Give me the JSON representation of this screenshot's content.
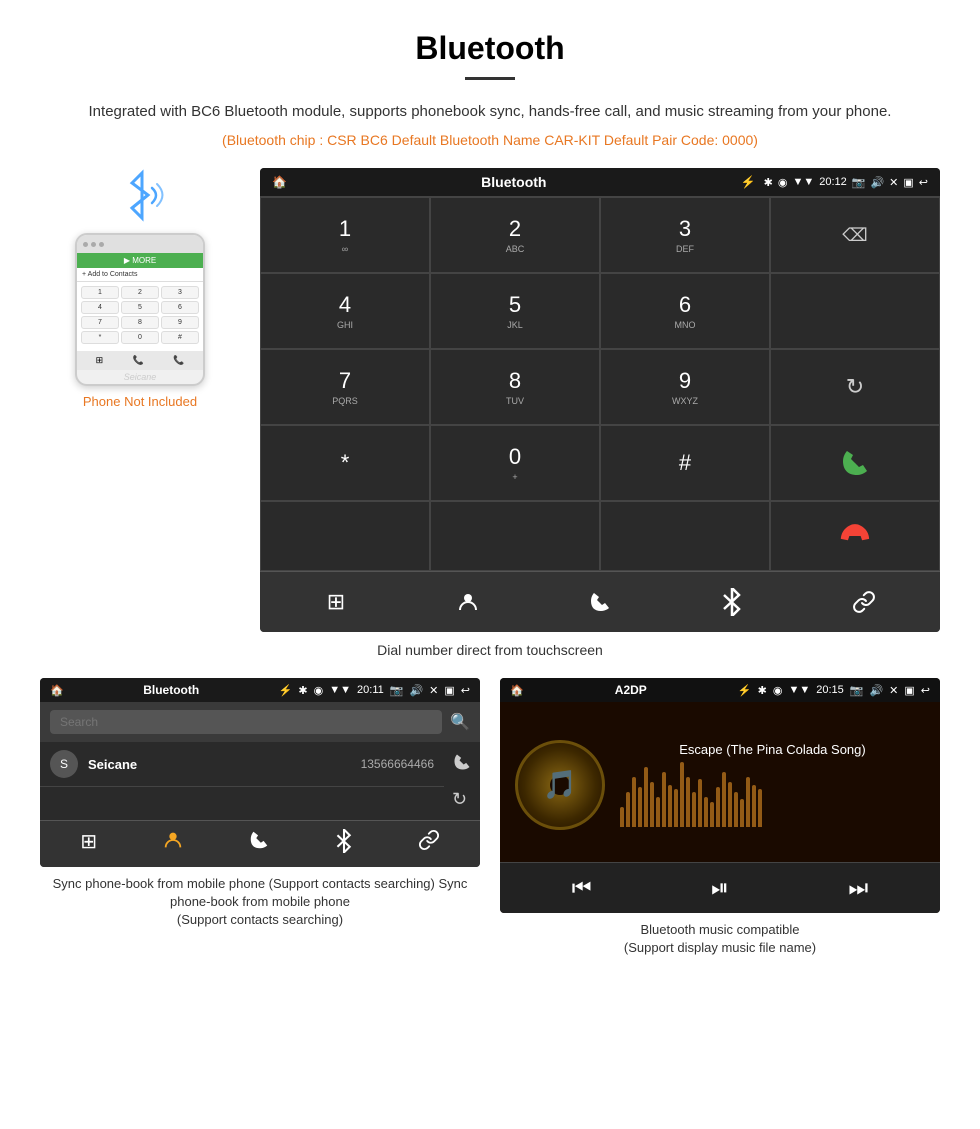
{
  "page": {
    "title": "Bluetooth",
    "divider": true,
    "description": "Integrated with BC6 Bluetooth module, supports phonebook sync, hands-free call, and music streaming from your phone.",
    "specs": "(Bluetooth chip : CSR BC6    Default Bluetooth Name CAR-KIT    Default Pair Code: 0000)",
    "main_caption": "Dial number direct from touchscreen",
    "phone_not_included": "Phone Not Included",
    "watermark": "Seicane"
  },
  "main_screen": {
    "status_bar": {
      "home_icon": "🏠",
      "title": "Bluetooth",
      "usb_icon": "⚡",
      "bluetooth_icon": "✱",
      "location_icon": "◉",
      "signal_icon": "▼",
      "time": "20:12",
      "camera_icon": "📷",
      "volume_icon": "🔊",
      "close_icon": "✕",
      "window_icon": "▣",
      "back_icon": "↩"
    },
    "dialpad": [
      {
        "label": "1",
        "sub": "∞",
        "col": 1
      },
      {
        "label": "2",
        "sub": "ABC",
        "col": 2
      },
      {
        "label": "3",
        "sub": "DEF",
        "col": 3
      },
      {
        "label": "",
        "sub": "",
        "col": 4,
        "type": "backspace",
        "icon": "⌫"
      },
      {
        "label": "4",
        "sub": "GHI",
        "col": 1
      },
      {
        "label": "5",
        "sub": "JKL",
        "col": 2
      },
      {
        "label": "6",
        "sub": "MNO",
        "col": 3
      },
      {
        "label": "",
        "sub": "",
        "col": 4,
        "type": "empty"
      },
      {
        "label": "7",
        "sub": "PQRS",
        "col": 1
      },
      {
        "label": "8",
        "sub": "TUV",
        "col": 2
      },
      {
        "label": "9",
        "sub": "WXYZ",
        "col": 3
      },
      {
        "label": "",
        "sub": "",
        "col": 4,
        "type": "refresh",
        "icon": "↻"
      },
      {
        "label": "*",
        "sub": "",
        "col": 1
      },
      {
        "label": "0",
        "sub": "+",
        "col": 2
      },
      {
        "label": "#",
        "sub": "",
        "col": 3
      },
      {
        "label": "📞",
        "sub": "",
        "col": 4,
        "type": "call-green"
      },
      {
        "label": "📞",
        "sub": "",
        "col": 4,
        "type": "call-red"
      }
    ],
    "bottom_icons": [
      "⊞",
      "👤",
      "📞",
      "✱",
      "🔗"
    ]
  },
  "phonebook_screen": {
    "status_bar": {
      "title": "Bluetooth",
      "time": "20:11"
    },
    "search_placeholder": "Search",
    "contacts": [
      {
        "initial": "S",
        "name": "Seicane",
        "number": "13566664466"
      }
    ],
    "right_icons": [
      "📞",
      "↻"
    ],
    "bottom_icons": [
      "⊞",
      "👤",
      "📞",
      "✱",
      "🔗"
    ],
    "caption": "Sync phone-book from mobile phone\n(Support contacts searching)"
  },
  "music_screen": {
    "status_bar": {
      "title": "A2DP",
      "time": "20:15"
    },
    "song_title": "Escape (The Pina Colada Song)",
    "viz_bars": [
      20,
      35,
      50,
      40,
      60,
      45,
      30,
      55,
      42,
      38,
      65,
      50,
      35,
      48,
      30,
      25,
      40,
      55,
      45,
      35,
      28,
      50,
      42,
      38
    ],
    "controls": [
      "⏮",
      "⏯",
      "⏭"
    ],
    "caption": "Bluetooth music compatible\n(Support display music file name)"
  }
}
